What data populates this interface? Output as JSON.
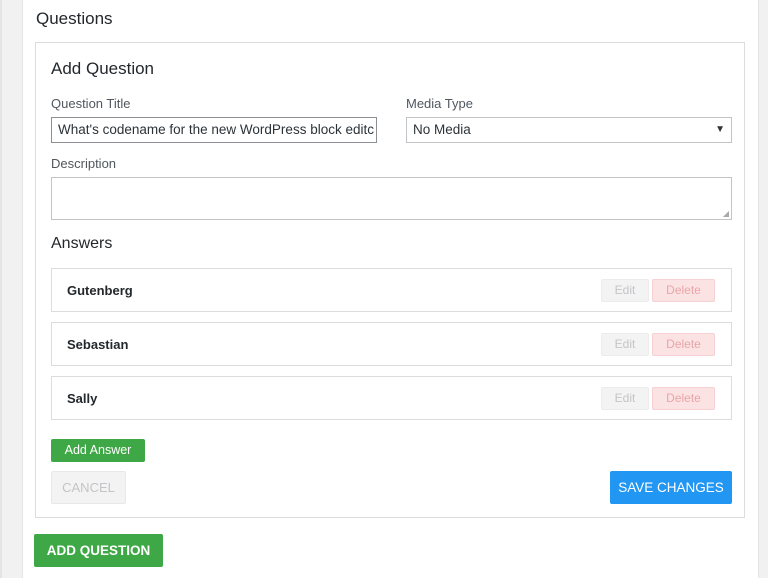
{
  "section": {
    "title": "Questions"
  },
  "form": {
    "title": "Add Question",
    "question_title_label": "Question Title",
    "question_title_value": "What's codename for the new WordPress block editc",
    "media_type_label": "Media Type",
    "media_type_value": "No Media",
    "description_label": "Description",
    "description_value": ""
  },
  "answers": {
    "title": "Answers",
    "items": [
      {
        "label": "Gutenberg",
        "edit_label": "Edit",
        "delete_label": "Delete"
      },
      {
        "label": "Sebastian",
        "edit_label": "Edit",
        "delete_label": "Delete"
      },
      {
        "label": "Sally",
        "edit_label": "Edit",
        "delete_label": "Delete"
      }
    ],
    "add_answer_label": "Add Answer"
  },
  "actions": {
    "cancel_label": "CANCEL",
    "save_label": "SAVE CHANGES",
    "add_question_label": "ADD QUESTION"
  },
  "colors": {
    "primary_green": "#3fa846",
    "save_blue": "#2196f3",
    "delete_pink": "#fbe3e4"
  }
}
